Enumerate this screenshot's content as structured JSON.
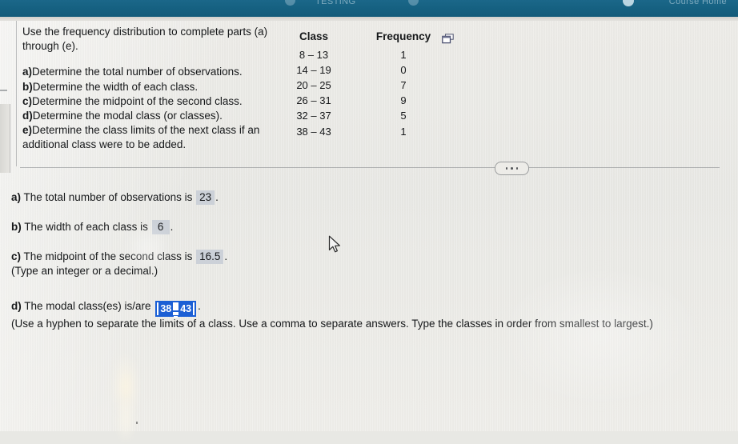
{
  "topbar": {
    "title_faint": "TESTING",
    "right_faint": "Course Home",
    "accent_color": "#156080"
  },
  "problem": {
    "intro": "Use the frequency distribution to complete parts (a) through (e).",
    "parts": [
      {
        "label": "a)",
        "text": "Determine the total number of observations."
      },
      {
        "label": "b)",
        "text": "Determine the width of each class."
      },
      {
        "label": "c)",
        "text": "Determine the midpoint of the second class."
      },
      {
        "label": "d)",
        "text": "Determine the modal class (or classes)."
      },
      {
        "label": "e)",
        "text": "Determine the class limits of the next class if an additional class were to be added."
      }
    ]
  },
  "freq_table": {
    "headers": [
      "Class",
      "Frequency"
    ],
    "rows": [
      {
        "class": "8 – 13",
        "frequency": "1"
      },
      {
        "class": "14 – 19",
        "frequency": "0"
      },
      {
        "class": "20 – 25",
        "frequency": "7"
      },
      {
        "class": "26 – 31",
        "frequency": "9"
      },
      {
        "class": "32 – 37",
        "frequency": "5"
      },
      {
        "class": "38 – 43",
        "frequency": "1"
      }
    ],
    "popup_icon": "popup-window-icon"
  },
  "toolbar": {
    "more_options_icon": "ellipsis-icon"
  },
  "answers": {
    "a": {
      "prefix_label": "a)",
      "prefix_text": " The total number of observations is ",
      "value": "23",
      "suffix": "."
    },
    "b": {
      "prefix_label": "b)",
      "prefix_text": " The width of each class is ",
      "value": "6",
      "suffix": "."
    },
    "c": {
      "prefix_label": "c)",
      "prefix_text": " The midpoint of the second class is ",
      "value": "16.5",
      "suffix": ".",
      "hint": "(Type an integer or a decimal.)"
    },
    "d": {
      "prefix_label": "d)",
      "prefix_text": " The modal class(es) is/are ",
      "input_value": "38-43",
      "input_left": "38",
      "input_right": "43",
      "input_separator": "-",
      "suffix": ".",
      "hint": "(Use a hyphen to separate the limits of a class. Use a comma to separate answers. Type the classes in order from smallest to largest.)",
      "selection_color": "#1c5fd4",
      "focus_border_color": "#1a5fd6"
    }
  }
}
